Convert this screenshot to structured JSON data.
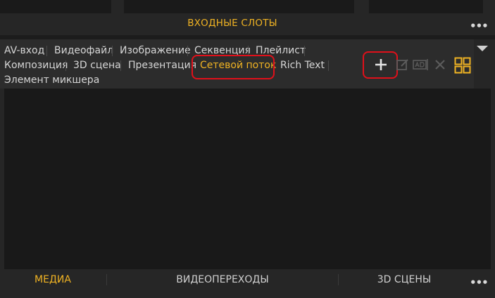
{
  "slots": {
    "title": "ВХОДНЫЕ СЛОТЫ",
    "more_label": "•••"
  },
  "source_tabs": [
    {
      "label": "AV-вход"
    },
    {
      "label": "Видеофайл"
    },
    {
      "label": "Изображение"
    },
    {
      "label": "Секвенция"
    },
    {
      "label": "Плейлист"
    },
    {
      "label": "Композиция"
    },
    {
      "label": "3D сцена"
    },
    {
      "label": "Презентация"
    },
    {
      "label": "Сетевой поток",
      "active": true
    },
    {
      "label": "Rich Text"
    },
    {
      "label": "Элемент микшера"
    }
  ],
  "toolbar": {
    "add_icon": "plus-icon",
    "edit_icon": "edit-icon",
    "rename_icon": "rename-icon",
    "delete_icon": "close-icon",
    "view_icon": "grid-view-icon"
  },
  "bottom_tabs": [
    {
      "label": "МЕДИА",
      "active": true
    },
    {
      "label": "ВИДЕОПЕРЕХОДЫ"
    },
    {
      "label": "3D СЦЕНЫ"
    }
  ],
  "bottom_more_label": "•••",
  "colors": {
    "accent": "#f0b323",
    "highlight": "#e0101a",
    "panel": "#262626",
    "content": "#191919"
  }
}
